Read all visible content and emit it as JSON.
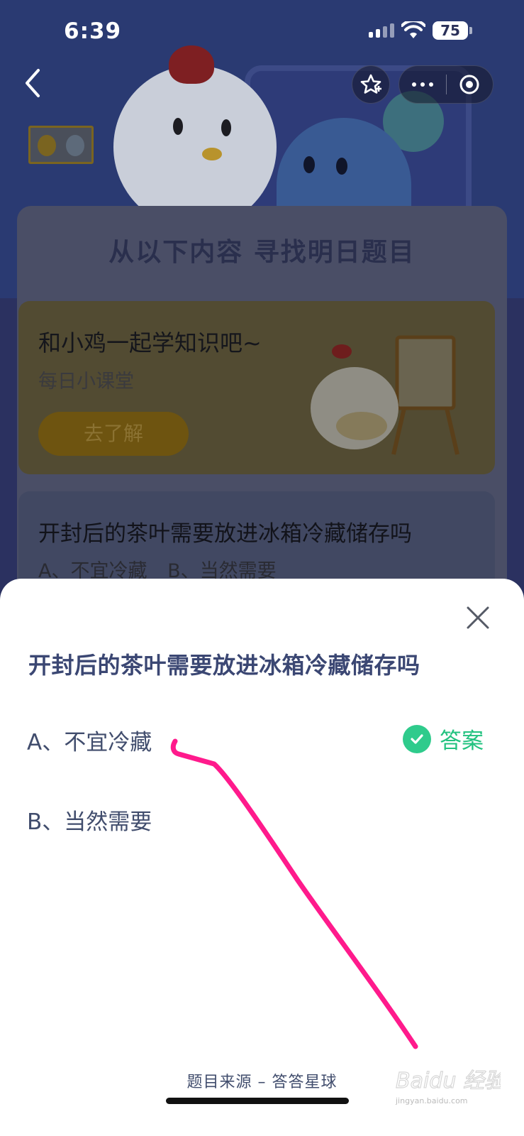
{
  "status_bar": {
    "time": "6:39",
    "battery": "75"
  },
  "nav": {
    "back_icon": "chevron-left-icon",
    "star_icon": "star-add-icon",
    "more_icon": "more-dots-icon",
    "close_icon": "target-circle-icon"
  },
  "background": {
    "panel_title": "从以下内容 寻找明日题目",
    "card1": {
      "title": "和小鸡一起学知识吧~",
      "subtitle": "每日小课堂",
      "button": "去了解"
    },
    "card2": {
      "question": "开封后的茶叶需要放进冰箱冷藏储存吗",
      "option_a": "A、不宜冷藏",
      "option_b": "B、当然需要"
    }
  },
  "sheet": {
    "question": "开封后的茶叶需要放进冰箱冷藏储存吗",
    "options": [
      {
        "label": "A、不宜冷藏",
        "is_answer": true
      },
      {
        "label": "B、当然需要",
        "is_answer": false
      }
    ],
    "answer_label": "答案",
    "source": "题目来源 – 答答星球"
  },
  "watermark": {
    "brand": "Baidu 经验",
    "url": "jingyan.baidu.com"
  },
  "colors": {
    "accent_green": "#22c27f",
    "question_text": "#3b4773",
    "annotation_pink": "#ff1a8c"
  }
}
